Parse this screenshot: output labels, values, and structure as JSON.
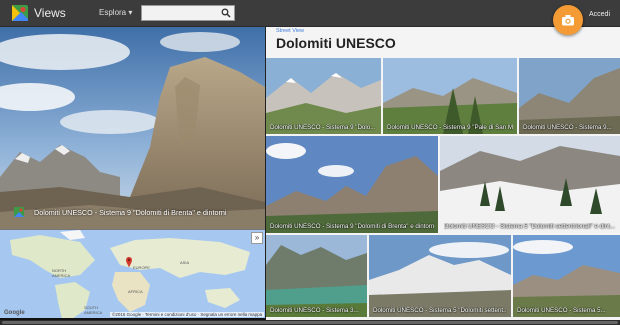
{
  "header": {
    "app_title": "Views",
    "explore_label": "Esplora ▾",
    "search_placeholder": "",
    "login_label": "Accedi"
  },
  "left_panel": {
    "pano_caption": "Dolomiti UNESCO - Sistema 9 \"Dolomiti di Brenta\" e dintorni",
    "map": {
      "labels": {
        "north_america": "NORTH\nAMERICA",
        "europe": "EUROPE",
        "asia": "ASIA",
        "africa": "AFRICA",
        "south_america": "SOUTH\nAMERICA"
      },
      "attribution": "©2015 Google · Termini e condizioni d'uso · Segnala un errore nella mappa",
      "brand": "Google",
      "expand_icon": "»"
    }
  },
  "right_panel": {
    "kicker": "Street View",
    "title": "Dolomiti UNESCO",
    "tiles": [
      {
        "caption": "Dolomiti UNESCO - Sistema 9 \"Dolo..."
      },
      {
        "caption": "Dolomiti UNESCO - Sistema 9 \"Pale di San M..."
      },
      {
        "caption": "Dolomiti UNESCO - Sistema 9..."
      },
      {
        "caption": "Dolomiti UNESCO - Sistema 9 \"Dolomiti di Brenta\" e dintorni"
      },
      {
        "caption": "Dolomiti UNESCO - Sistema 5 \"Dolomiti settentrionali\" e dint..."
      },
      {
        "caption": "Dolomiti UNESCO - Sistema 3..."
      },
      {
        "caption": "Dolomiti UNESCO - Sistema 5 \"Dolomiti settent..."
      },
      {
        "caption": "Dolomiti UNESCO - Sistema 5..."
      }
    ]
  },
  "colors": {
    "topbar": "#3c3c3c",
    "accent_camera": "#f59b35",
    "link_blue": "#3b7bd6"
  }
}
